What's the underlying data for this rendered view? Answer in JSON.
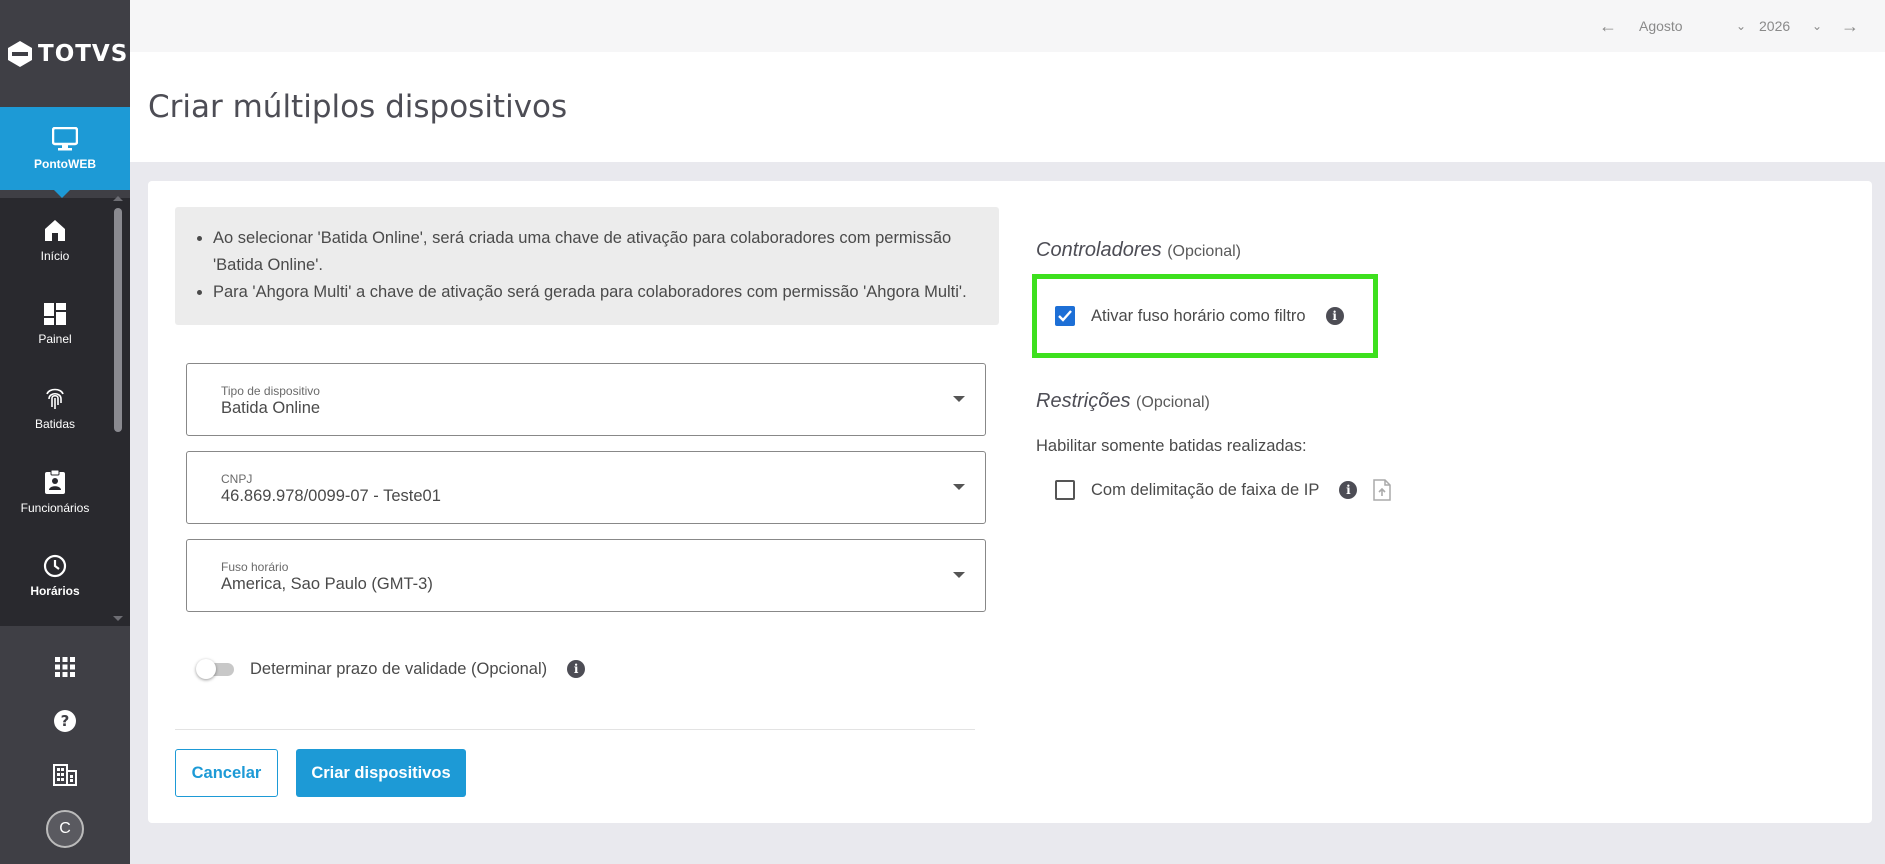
{
  "brand": {
    "name": "TOTVS",
    "app_tile": "PontoWEB"
  },
  "sidebar": {
    "items": [
      {
        "label": "Início",
        "icon": "home-icon"
      },
      {
        "label": "Painel",
        "icon": "dashboard-icon"
      },
      {
        "label": "Batidas",
        "icon": "fingerprint-icon"
      },
      {
        "label": "Funcionários",
        "icon": "badge-icon"
      },
      {
        "label": "Horários",
        "icon": "clock-icon"
      }
    ],
    "avatar_initial": "C"
  },
  "topbar": {
    "month": "Agosto",
    "year": "2026"
  },
  "page": {
    "title": "Criar múltiplos dispositivos"
  },
  "info": {
    "items": [
      "Ao selecionar 'Batida Online', será criada uma chave de ativação para colaboradores com permissão 'Batida Online'.",
      "Para 'Ahgora Multi' a chave de ativação será gerada para colaboradores com permissão 'Ahgora Multi'."
    ]
  },
  "form": {
    "device_type": {
      "label": "Tipo de dispositivo",
      "value": "Batida Online"
    },
    "cnpj": {
      "label": "CNPJ",
      "value": "46.869.978/0099-07 - Teste01"
    },
    "timezone": {
      "label": "Fuso horário",
      "value": "America, Sao Paulo (GMT-3)"
    },
    "validity_toggle": {
      "label": "Determinar prazo de validade (Opcional)",
      "on": false
    }
  },
  "actions": {
    "cancel": "Cancelar",
    "create": "Criar dispositivos"
  },
  "controllers": {
    "title": "Controladores",
    "optional": "(Opcional)",
    "timezone_filter": {
      "label": "Ativar fuso horário como filtro",
      "checked": true
    }
  },
  "restrictions": {
    "title": "Restrições",
    "optional": "(Opcional)",
    "subtitle": "Habilitar somente batidas realizadas:",
    "ip_range": {
      "label": "Com delimitação de faixa de IP",
      "checked": false
    }
  },
  "colors": {
    "accent": "#1d9ad6",
    "highlight": "#3de01e",
    "sidebar": "#3f3f45"
  }
}
